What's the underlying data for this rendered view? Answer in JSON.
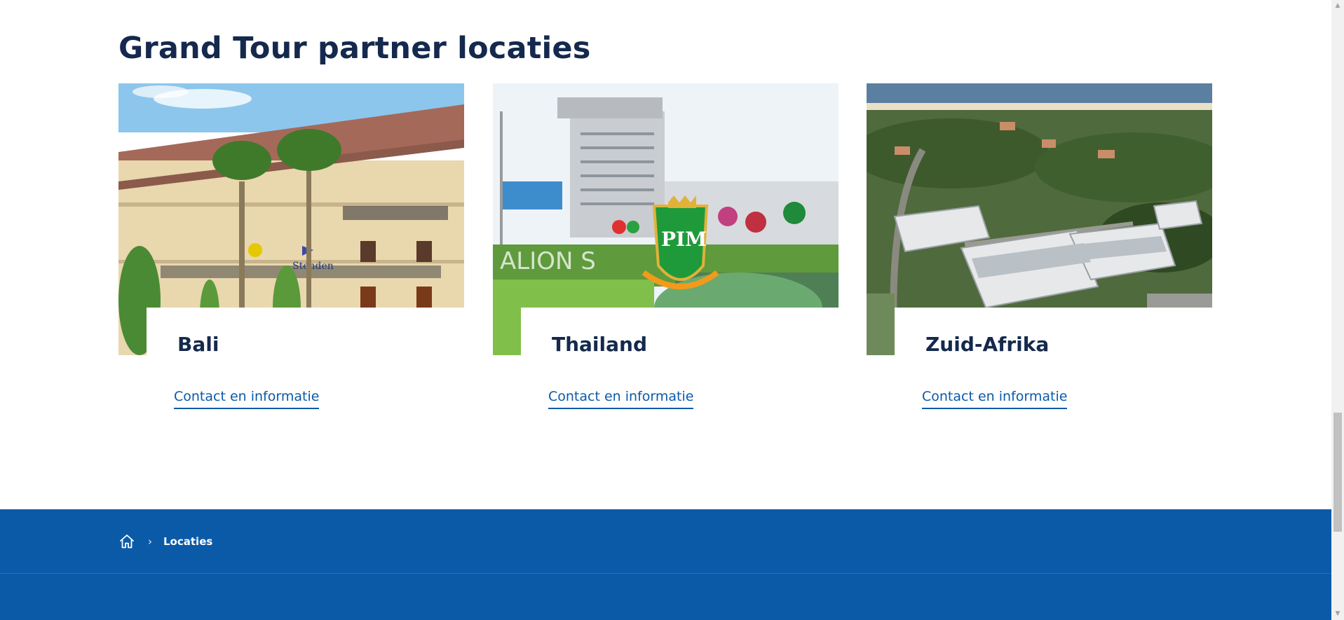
{
  "section": {
    "title": "Grand Tour partner locaties"
  },
  "cards": [
    {
      "title": "Bali",
      "link": "Contact en informatie",
      "image": "bali-campus-photo"
    },
    {
      "title": "Thailand",
      "link": "Contact en informatie",
      "image": "thailand-pim-campus-photo"
    },
    {
      "title": "Zuid-Afrika",
      "link": "Contact en informatie",
      "image": "south-africa-aerial-photo"
    }
  ],
  "footer": {
    "breadcrumb": {
      "home_icon": "home-icon",
      "separator": "›",
      "current": "Locaties"
    }
  },
  "colors": {
    "brand_blue": "#0b5aa8",
    "heading_navy": "#14294d"
  }
}
